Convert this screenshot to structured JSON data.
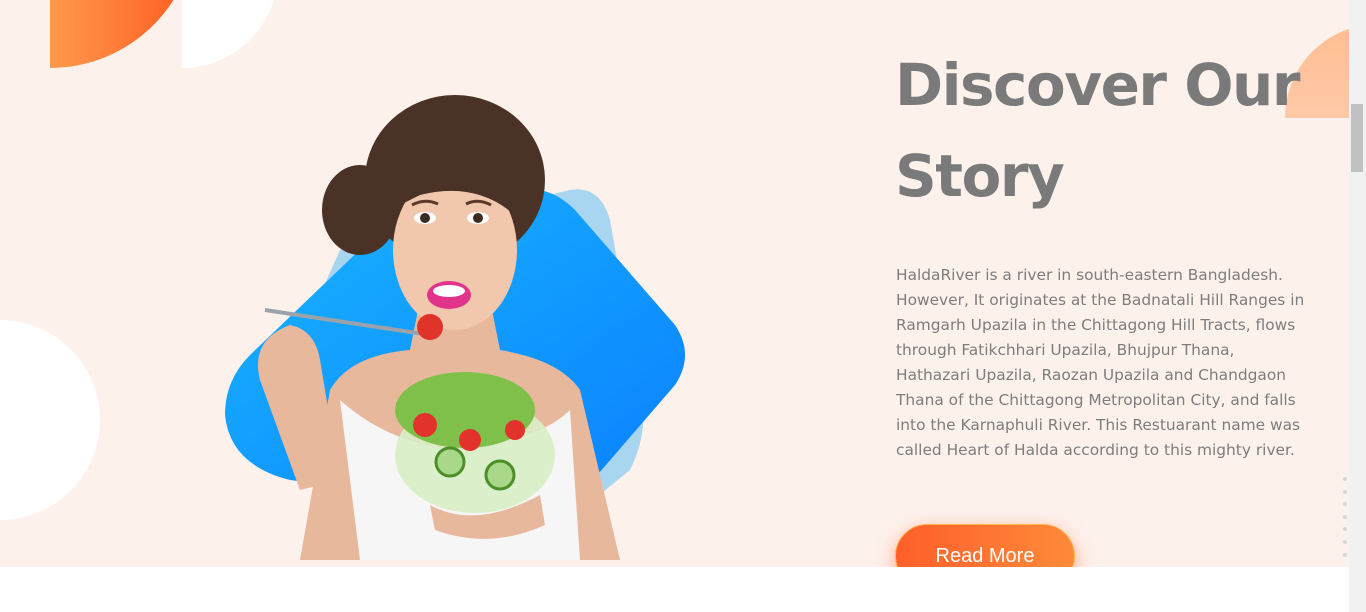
{
  "story": {
    "title_line1": "Discover Our",
    "title_line2": "Story",
    "paragraph": "HaldaRiver is a river in south-eastern Bangladesh. However, It originates at the Badnatali Hill Ranges in Ramgarh Upazila in the Chittagong Hill Tracts, flows through Fatikchhari Upazila, Bhujpur Thana, Hathazari Upazila, Raozan Upazila and Chandgaon Thana of the Chittagong Metropolitan City, and falls into the Karnaphuli River. This Restuarant name was called Heart of Halda according to this mighty river.",
    "read_more_label": "Read More"
  },
  "colors": {
    "section_bg": "#fdf1ec",
    "title": "#7a7a7a",
    "body_text": "#7d7d7d",
    "accent_orange": "#ff5f2a",
    "accent_blue": "#0a8cff"
  },
  "icons": [
    "woman-eating-salad-image",
    "section-indicator-dots"
  ]
}
